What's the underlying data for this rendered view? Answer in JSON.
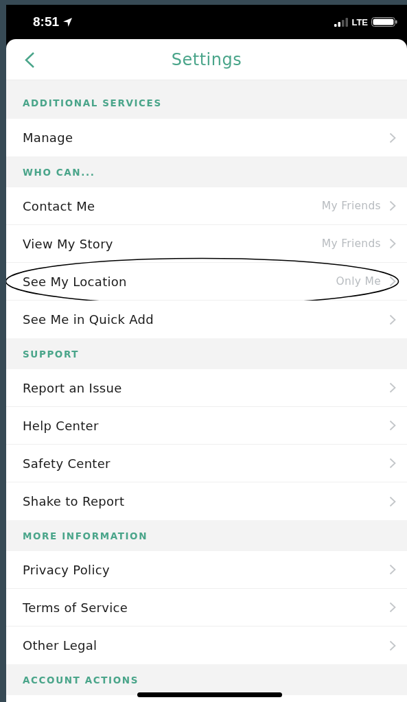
{
  "status_bar": {
    "time": "8:51",
    "network": "LTE"
  },
  "header": {
    "title": "Settings"
  },
  "sections": [
    {
      "title": "ADDITIONAL SERVICES",
      "rows": [
        {
          "label": "Manage",
          "circled": false
        }
      ]
    },
    {
      "title": "WHO CAN...",
      "rows": [
        {
          "label": "Contact Me",
          "value": "My Friends",
          "circled": false
        },
        {
          "label": "View My Story",
          "value": "My Friends",
          "circled": false
        },
        {
          "label": "See My Location",
          "value": "Only Me",
          "circled": true
        },
        {
          "label": "See Me in Quick Add",
          "circled": false
        }
      ]
    },
    {
      "title": "SUPPORT",
      "rows": [
        {
          "label": "Report an Issue",
          "circled": false
        },
        {
          "label": "Help Center",
          "circled": false
        },
        {
          "label": "Safety Center",
          "circled": false
        },
        {
          "label": "Shake to Report",
          "circled": false
        }
      ]
    },
    {
      "title": "MORE INFORMATION",
      "rows": [
        {
          "label": "Privacy Policy",
          "circled": false
        },
        {
          "label": "Terms of Service",
          "circled": false
        },
        {
          "label": "Other Legal",
          "circled": false
        }
      ]
    },
    {
      "title": "ACCOUNT ACTIONS"
    }
  ]
}
